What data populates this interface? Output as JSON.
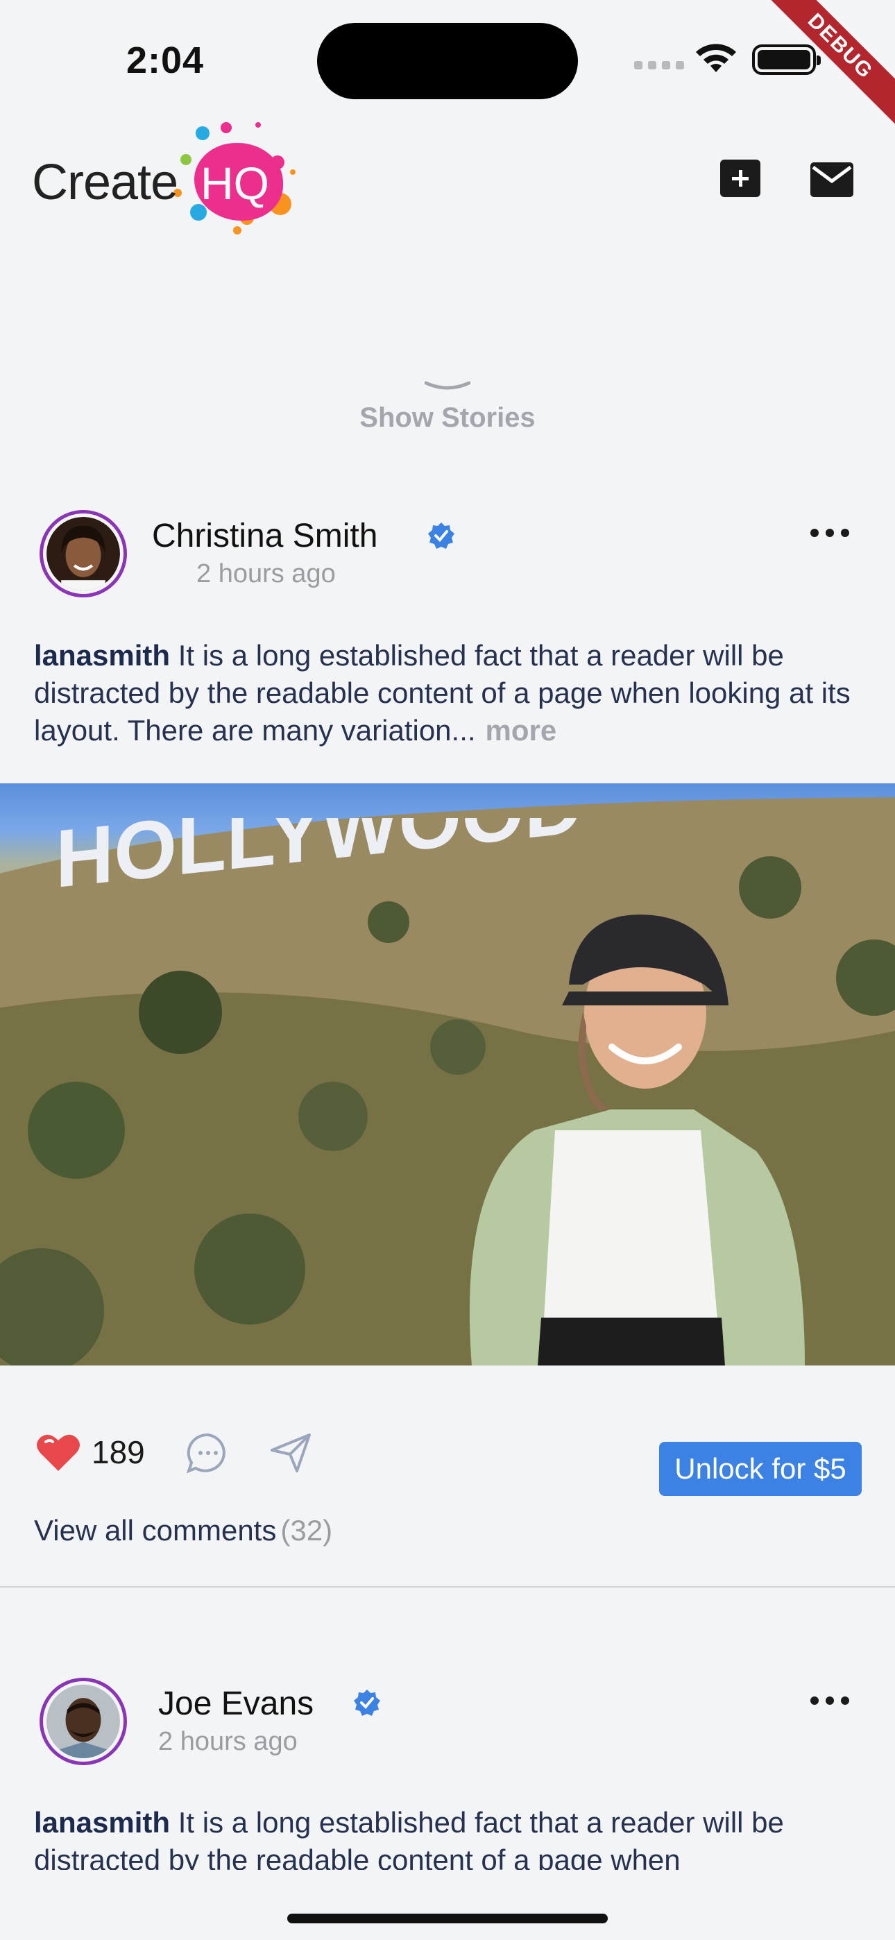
{
  "status_bar": {
    "time": "2:04",
    "debug_label": "DEBUG"
  },
  "header": {
    "logo_text": "Create",
    "logo_hq": "HQ",
    "add_icon": "plus-square-icon",
    "mail_icon": "mail-icon"
  },
  "stories": {
    "label": "Show Stories",
    "icon": "chevron-down-icon"
  },
  "posts": [
    {
      "author": "Christina Smith",
      "time": "2 hours ago",
      "username": "lanasmith",
      "caption": " It is a long established fact that a reader will be distracted by the readable content of a page when looking at its layout. There are many variation...",
      "more_label": "more",
      "likes": "189",
      "unlock_label": "Unlock for $5",
      "comments_label": "View all comments",
      "comments_count": "(32)",
      "photo_sign": "HOLLYWOOD"
    },
    {
      "author": "Joe Evans",
      "time": "2 hours ago",
      "username": "lanasmith",
      "caption": " It is a long established fact that a reader will be distracted by the readable content of a page when"
    }
  ],
  "colors": {
    "accent": "#3b82e4",
    "avatar_ring": "#8a34b6",
    "like": "#e8474c",
    "brand_pink": "#ec2f8d"
  }
}
